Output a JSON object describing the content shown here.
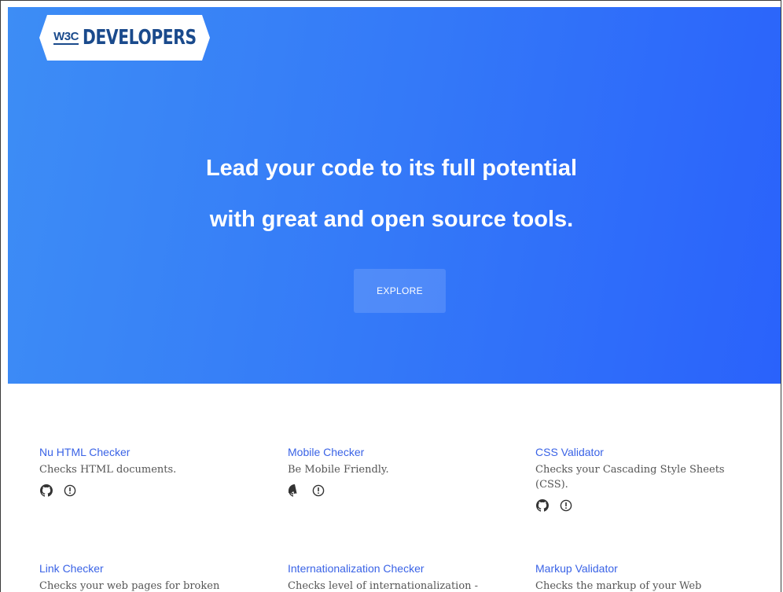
{
  "header": {
    "logo_w3c": "W3C",
    "logo_developers": "DEVELOPERS"
  },
  "hero": {
    "headline_line1": "Lead your code to its full potential",
    "headline_line2": "with great and open source tools.",
    "cta_label": "EXPLORE"
  },
  "tools": [
    {
      "title": "Nu HTML Checker",
      "description": "Checks HTML documents.",
      "icons": [
        "github-icon",
        "issues-icon"
      ]
    },
    {
      "title": "Mobile Checker",
      "description": "Be Mobile Friendly.",
      "icons": [
        "github-icon",
        "issues-icon"
      ]
    },
    {
      "title": "CSS Validator",
      "description": "Checks your Cascading Style Sheets (CSS).",
      "icons": [
        "github-icon",
        "issues-icon"
      ]
    },
    {
      "title": "Link Checker",
      "description": "Checks your web pages for broken"
    },
    {
      "title": "Internationalization Checker",
      "description": "Checks level of internationalization -"
    },
    {
      "title": "Markup Validator",
      "description": "Checks the markup of your Web"
    }
  ],
  "colors": {
    "hero_gradient_start": "#3d8df5",
    "hero_gradient_end": "#2a62fb",
    "link": "#3a63e6",
    "logo_text": "#1a4a8c"
  }
}
